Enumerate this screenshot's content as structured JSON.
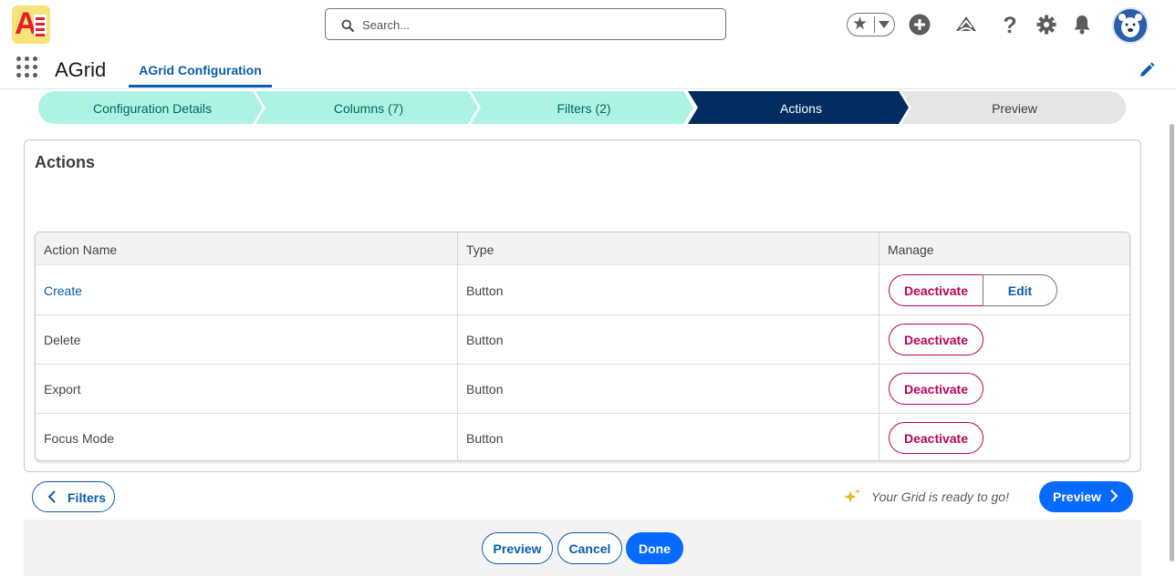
{
  "header": {
    "search_placeholder": "Search...",
    "icons": [
      "app-logo",
      "search-icon",
      "star-icon",
      "chevron-down-icon",
      "add-icon",
      "trailhead-icon",
      "help-icon",
      "gear-icon",
      "bell-icon",
      "avatar"
    ]
  },
  "nav": {
    "app_name": "AGrid",
    "tab_label": "AGrid Configuration"
  },
  "path": {
    "steps": [
      {
        "label": "Configuration Details",
        "state": "complete"
      },
      {
        "label": "Columns (7)",
        "state": "complete"
      },
      {
        "label": "Filters (2)",
        "state": "complete"
      },
      {
        "label": "Actions",
        "state": "current"
      },
      {
        "label": "Preview",
        "state": "incomplete"
      }
    ]
  },
  "card": {
    "title": "Actions"
  },
  "table": {
    "headers": [
      "Action Name",
      "Type",
      "Manage"
    ],
    "rows": [
      {
        "name": "Create",
        "type": "Button",
        "deactivate": "Deactivate",
        "edit": "Edit"
      },
      {
        "name": "Delete",
        "type": "Button",
        "deactivate": "Deactivate"
      },
      {
        "name": "Export",
        "type": "Button",
        "deactivate": "Deactivate"
      },
      {
        "name": "Focus Mode",
        "type": "Button",
        "deactivate": "Deactivate"
      }
    ]
  },
  "wizard_nav": {
    "back_label": "Filters",
    "ready_message": "Your Grid is ready to go!",
    "next_label": "Preview"
  },
  "footer": {
    "preview_label": "Preview",
    "cancel_label": "Cancel",
    "done_label": "Done"
  },
  "colors": {
    "brand": "#066afe",
    "link": "#0b5cab",
    "destructive": "#b60554",
    "path_complete": "#acf3e4",
    "path_current": "#032d60",
    "path_incomplete": "#e5e5e5"
  }
}
